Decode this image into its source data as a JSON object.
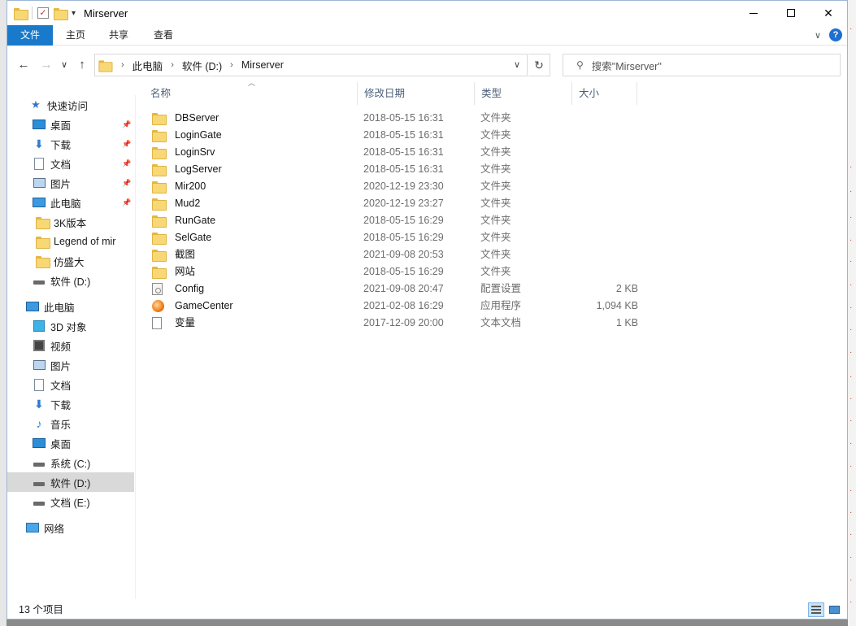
{
  "window": {
    "title": "Mirserver"
  },
  "ribbon": {
    "tabs": [
      "文件",
      "主页",
      "共享",
      "查看"
    ],
    "help_label": "?"
  },
  "address": {
    "crumbs": [
      "此电脑",
      "软件 (D:)",
      "Mirserver"
    ],
    "search_placeholder": "搜索\"Mirserver\""
  },
  "sidebar": {
    "items": [
      {
        "label": "快速访问",
        "icon": "star-icon",
        "pinned": false
      },
      {
        "label": "桌面",
        "icon": "desktop-icon",
        "pinned": true
      },
      {
        "label": "下载",
        "icon": "download-icon",
        "pinned": true
      },
      {
        "label": "文档",
        "icon": "document-icon",
        "pinned": true
      },
      {
        "label": "图片",
        "icon": "picture-icon",
        "pinned": true
      },
      {
        "label": "此电脑",
        "icon": "computer-icon",
        "pinned": true
      },
      {
        "label": "3K版本",
        "icon": "folder-icon",
        "pinned": false
      },
      {
        "label": "Legend of mir",
        "icon": "folder-icon",
        "pinned": false
      },
      {
        "label": "仿盛大",
        "icon": "folder-icon",
        "pinned": false
      },
      {
        "label": "软件 (D:)",
        "icon": "drive-icon",
        "pinned": false
      },
      {
        "label": "此电脑",
        "icon": "computer-icon",
        "pinned": false
      },
      {
        "label": "3D 对象",
        "icon": "cube-icon",
        "pinned": false
      },
      {
        "label": "视频",
        "icon": "video-icon",
        "pinned": false
      },
      {
        "label": "图片",
        "icon": "picture-icon",
        "pinned": false
      },
      {
        "label": "文档",
        "icon": "document-icon",
        "pinned": false
      },
      {
        "label": "下载",
        "icon": "download-icon",
        "pinned": false
      },
      {
        "label": "音乐",
        "icon": "music-icon",
        "pinned": false
      },
      {
        "label": "桌面",
        "icon": "desktop-icon",
        "pinned": false
      },
      {
        "label": "系统 (C:)",
        "icon": "drive-icon",
        "pinned": false
      },
      {
        "label": "软件 (D:)",
        "icon": "drive-icon",
        "pinned": false
      },
      {
        "label": "文档 (E:)",
        "icon": "drive-icon",
        "pinned": false
      },
      {
        "label": "网络",
        "icon": "network-icon",
        "pinned": false
      }
    ]
  },
  "columns": [
    "名称",
    "修改日期",
    "类型",
    "大小"
  ],
  "files": [
    {
      "name": "DBServer",
      "date": "2018-05-15 16:31",
      "type": "文件夹",
      "size": "",
      "icon": "folder-icon"
    },
    {
      "name": "LoginGate",
      "date": "2018-05-15 16:31",
      "type": "文件夹",
      "size": "",
      "icon": "folder-icon"
    },
    {
      "name": "LoginSrv",
      "date": "2018-05-15 16:31",
      "type": "文件夹",
      "size": "",
      "icon": "folder-icon"
    },
    {
      "name": "LogServer",
      "date": "2018-05-15 16:31",
      "type": "文件夹",
      "size": "",
      "icon": "folder-icon"
    },
    {
      "name": "Mir200",
      "date": "2020-12-19 23:30",
      "type": "文件夹",
      "size": "",
      "icon": "folder-icon"
    },
    {
      "name": "Mud2",
      "date": "2020-12-19 23:27",
      "type": "文件夹",
      "size": "",
      "icon": "folder-icon"
    },
    {
      "name": "RunGate",
      "date": "2018-05-15 16:29",
      "type": "文件夹",
      "size": "",
      "icon": "folder-icon"
    },
    {
      "name": "SelGate",
      "date": "2018-05-15 16:29",
      "type": "文件夹",
      "size": "",
      "icon": "folder-icon"
    },
    {
      "name": "截图",
      "date": "2021-09-08 20:53",
      "type": "文件夹",
      "size": "",
      "icon": "folder-icon"
    },
    {
      "name": "网站",
      "date": "2018-05-15 16:29",
      "type": "文件夹",
      "size": "",
      "icon": "folder-icon"
    },
    {
      "name": "Config",
      "date": "2021-09-08 20:47",
      "type": "配置设置",
      "size": "2 KB",
      "icon": "config-file-icon"
    },
    {
      "name": "GameCenter",
      "date": "2021-02-08 16:29",
      "type": "应用程序",
      "size": "1,094 KB",
      "icon": "app-icon"
    },
    {
      "name": "变量",
      "date": "2017-12-09 20:00",
      "type": "文本文档",
      "size": "1 KB",
      "icon": "text-file-icon"
    }
  ],
  "status": {
    "count_text": "13 个项目"
  }
}
